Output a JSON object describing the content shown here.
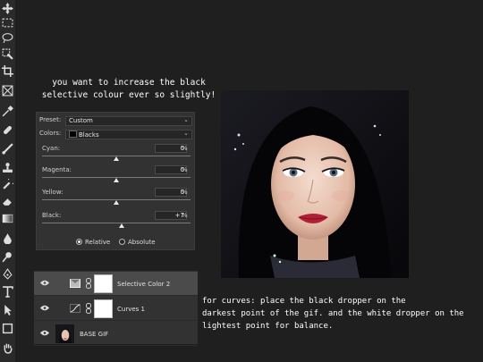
{
  "annotations": {
    "top": "you want to increase the black\nselective colour ever so slightly!",
    "bottom": "for curves: place the black dropper on the\ndarkest point of the gif. and the white dropper on the\nlightest point for balance."
  },
  "toolbar": {
    "tools": [
      "move-tool",
      "marquee-tool",
      "lasso-tool",
      "quick-select-tool",
      "crop-tool",
      "frame-tool",
      "eyedropper-tool",
      "healing-tool",
      "brush-tool",
      "stamp-tool",
      "history-brush-tool",
      "eraser-tool",
      "gradient-tool",
      "blur-tool",
      "dodge-tool",
      "pen-tool",
      "type-tool",
      "path-select-tool",
      "shape-tool",
      "hand-tool"
    ]
  },
  "selective_color": {
    "preset_label": "Preset:",
    "preset_value": "Custom",
    "colors_label": "Colors:",
    "colors_value": "Blacks",
    "sliders": [
      {
        "label": "Cyan:",
        "value": "0",
        "unit": "%",
        "level": 0.5
      },
      {
        "label": "Magenta:",
        "value": "0",
        "unit": "%",
        "level": 0.5
      },
      {
        "label": "Yellow:",
        "value": "0",
        "unit": "%",
        "level": 0.5
      },
      {
        "label": "Black:",
        "value": "+7",
        "unit": "%",
        "level": 0.535
      }
    ],
    "method_relative": "Relative",
    "method_absolute": "Absolute",
    "selected_method": "Relative"
  },
  "layers": [
    {
      "name": "Selective Color 2",
      "selected": true
    },
    {
      "name": "Curves 1",
      "selected": false
    },
    {
      "name": "BASE GIF",
      "selected": false
    }
  ],
  "colors": {
    "background": "#1f1f1f",
    "panel": "#323232",
    "selected_layer": "#4b4b4b",
    "text": "#ffffff"
  }
}
